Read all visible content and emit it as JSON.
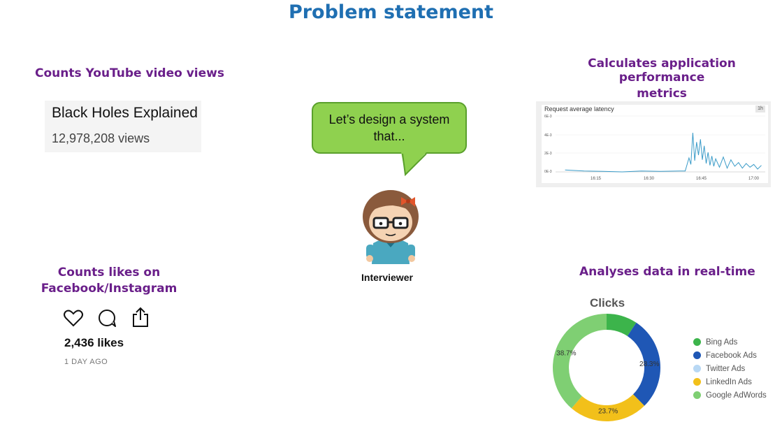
{
  "title": "Problem statement",
  "youtube": {
    "heading": "Counts YouTube video views",
    "video_title": "Black Holes Explained",
    "views": "12,978,208 views"
  },
  "speech": {
    "line1": "Let’s design a system",
    "line2": "that..."
  },
  "interviewer": {
    "label": "Interviewer"
  },
  "perf": {
    "heading_line1": "Calculates application performance",
    "heading_line2": "metrics",
    "chart_title": "Request average latency",
    "badge": "1h",
    "y_ticks": [
      "6E-3",
      "4E-3",
      "2E-3",
      "0E-3"
    ],
    "x_ticks": [
      "16:15",
      "16:30",
      "16:45",
      "17:00"
    ]
  },
  "social": {
    "heading_line1": "Counts likes on",
    "heading_line2": "Facebook/Instagram",
    "likes": "2,436 likes",
    "time": "1 DAY AGO",
    "icons": [
      "heart-icon",
      "comment-icon",
      "share-icon"
    ]
  },
  "realtime": {
    "heading": "Analyses data in real-time",
    "chart_title": "Clicks"
  },
  "chart_data": [
    {
      "type": "line",
      "title": "Request average latency",
      "xlabel": "",
      "ylabel": "",
      "x_ticks": [
        "16:15",
        "16:30",
        "16:45",
        "17:00"
      ],
      "y_ticks": [
        "0E-3",
        "2E-3",
        "4E-3",
        "6E-3"
      ],
      "ylim": [
        0,
        0.006
      ],
      "x": [
        16.05,
        16.15,
        16.25,
        16.35,
        16.45,
        16.55,
        16.65,
        16.68,
        16.7,
        16.71,
        16.72,
        16.73,
        16.74,
        16.75,
        16.76,
        16.77,
        16.78,
        16.79,
        16.8,
        16.81,
        16.82,
        16.83,
        16.84,
        16.86,
        16.88,
        16.9,
        16.92,
        16.94,
        16.96,
        16.98,
        17.0,
        17.02,
        17.04,
        17.06,
        17.08
      ],
      "values": [
        0.0002,
        0.0001,
        5e-05,
        0.0,
        0.0001,
        5e-05,
        0.0001,
        0.0001,
        0.0015,
        0.0008,
        0.0042,
        0.0012,
        0.0032,
        0.0018,
        0.0035,
        0.0013,
        0.0028,
        0.0009,
        0.0021,
        0.0007,
        0.0017,
        0.0006,
        0.0014,
        0.0005,
        0.0016,
        0.0004,
        0.0013,
        0.0006,
        0.001,
        0.0004,
        0.0009,
        0.0005,
        0.0008,
        0.0003,
        0.0007
      ],
      "grid": true
    },
    {
      "type": "pie",
      "title": "Clicks",
      "labels": [
        "Bing Ads",
        "Facebook Ads",
        "Twitter Ads",
        "LinkedIn Ads",
        "Google AdWords"
      ],
      "values": [
        9.3,
        28.3,
        0,
        23.7,
        38.7
      ],
      "display_labels": [
        "",
        "28.3%",
        "",
        "23.7%",
        "38.7%"
      ],
      "colors": [
        "#3cb44b",
        "#1f57b5",
        "#b8d8f4",
        "#f2c01a",
        "#7fcf73"
      ],
      "legend": "right"
    }
  ]
}
